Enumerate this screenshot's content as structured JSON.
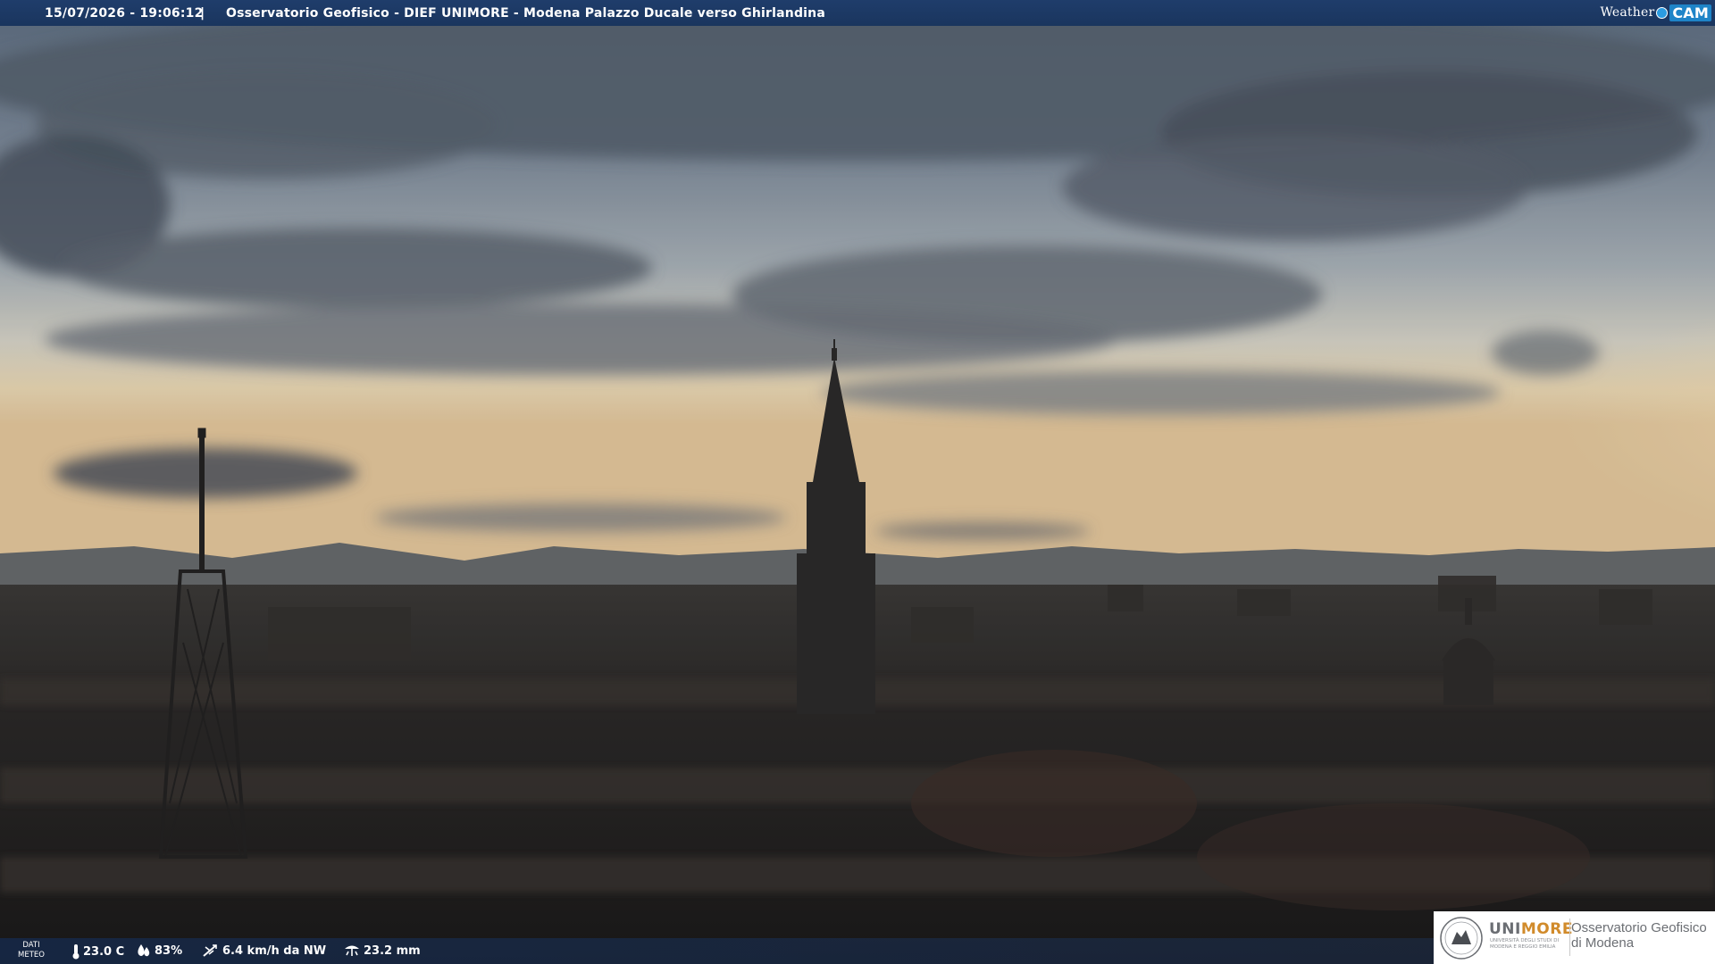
{
  "header": {
    "timestamp": "15/07/2026 - 19:06:12",
    "separator": "|",
    "caption": "Osservatorio Geofisico - DIEF UNIMORE - Modena Palazzo Ducale verso Ghirlandina",
    "brand_part1": "Weather",
    "brand_part2": "CAM"
  },
  "weather": {
    "label_line1": "DATI",
    "label_line2": "METEO",
    "temperature": "23.0 C",
    "humidity": "83%",
    "wind": "6.4 km/h da NW",
    "rain": "23.2 mm"
  },
  "logo": {
    "university_a": "UNI",
    "university_b": "MORE",
    "university_sub": "UNIVERSITÀ DEGLI STUDI DI MODENA E REGGIO EMILIA",
    "observatory_line1": "Osservatorio Geofisico",
    "observatory_line2": "di Modena"
  },
  "icons": {
    "temperature": "thermometer-icon",
    "humidity": "droplet-icon",
    "wind": "wind-icon",
    "rain": "rain-gauge-icon"
  },
  "colors": {
    "bar": "#1f3d6b",
    "brand_blue": "#1e84c8",
    "unimore_orange": "#d18b2b"
  }
}
